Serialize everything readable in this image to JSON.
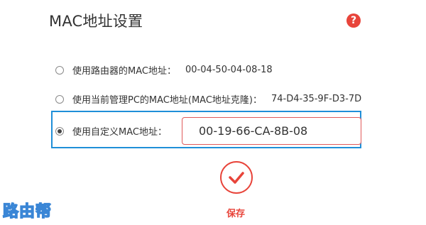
{
  "page": {
    "title": "MAC地址设置",
    "help_glyph": "?"
  },
  "options": [
    {
      "label": "使用路由器的MAC地址：",
      "value": "00-04-50-04-08-18",
      "checked": false
    },
    {
      "label": "使用当前管理PC的MAC地址(MAC地址克隆)：",
      "value": "74-D4-35-9F-D3-7D",
      "checked": false
    },
    {
      "label": "使用自定义MAC地址：",
      "value": "00-19-66-CA-8B-08",
      "checked": true
    }
  ],
  "save": {
    "label": "保存",
    "icon": "check-icon"
  },
  "watermark": {
    "text": "路由帮"
  },
  "colors": {
    "accent_red": "#e8443a",
    "highlight_blue": "#1f8fd8"
  }
}
